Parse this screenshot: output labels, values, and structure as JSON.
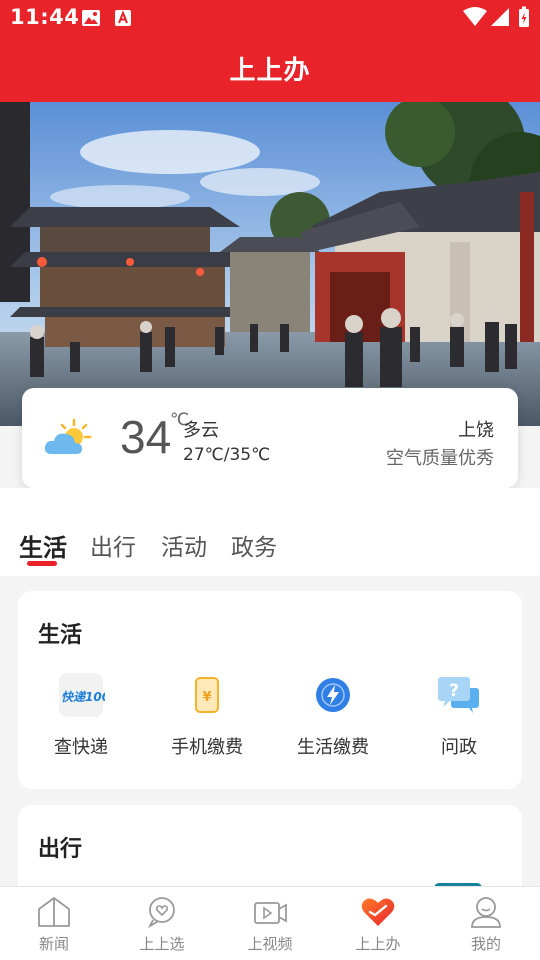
{
  "status_bar": {
    "time": "11:44"
  },
  "header": {
    "title": "上上办"
  },
  "weather": {
    "temperature": "34",
    "unit": "℃",
    "condition": "多云",
    "range": "27℃/35℃",
    "city": "上饶",
    "air_quality": "空气质量优秀"
  },
  "tabs": [
    {
      "label": "生活",
      "active": true
    },
    {
      "label": "出行",
      "active": false
    },
    {
      "label": "活动",
      "active": false
    },
    {
      "label": "政务",
      "active": false
    }
  ],
  "sections": [
    {
      "title": "生活",
      "items": [
        {
          "label": "查快递",
          "icon": "kuaidi100-icon",
          "icon_text": "快递100"
        },
        {
          "label": "手机缴费",
          "icon": "phone-payment-icon"
        },
        {
          "label": "生活缴费",
          "icon": "utility-payment-icon"
        },
        {
          "label": "问政",
          "icon": "question-chat-icon"
        }
      ]
    },
    {
      "title": "出行"
    }
  ],
  "bottom_nav": [
    {
      "label": "新闻",
      "icon": "news-house-icon",
      "active": false
    },
    {
      "label": "上上选",
      "icon": "heart-chat-icon",
      "active": false
    },
    {
      "label": "上视频",
      "icon": "video-icon",
      "active": false
    },
    {
      "label": "上上办",
      "icon": "heart-icon",
      "active": true
    },
    {
      "label": "我的",
      "icon": "profile-icon",
      "active": false
    }
  ],
  "colors": {
    "brand_red": "#e8232a",
    "background": "#f4f4f4"
  }
}
